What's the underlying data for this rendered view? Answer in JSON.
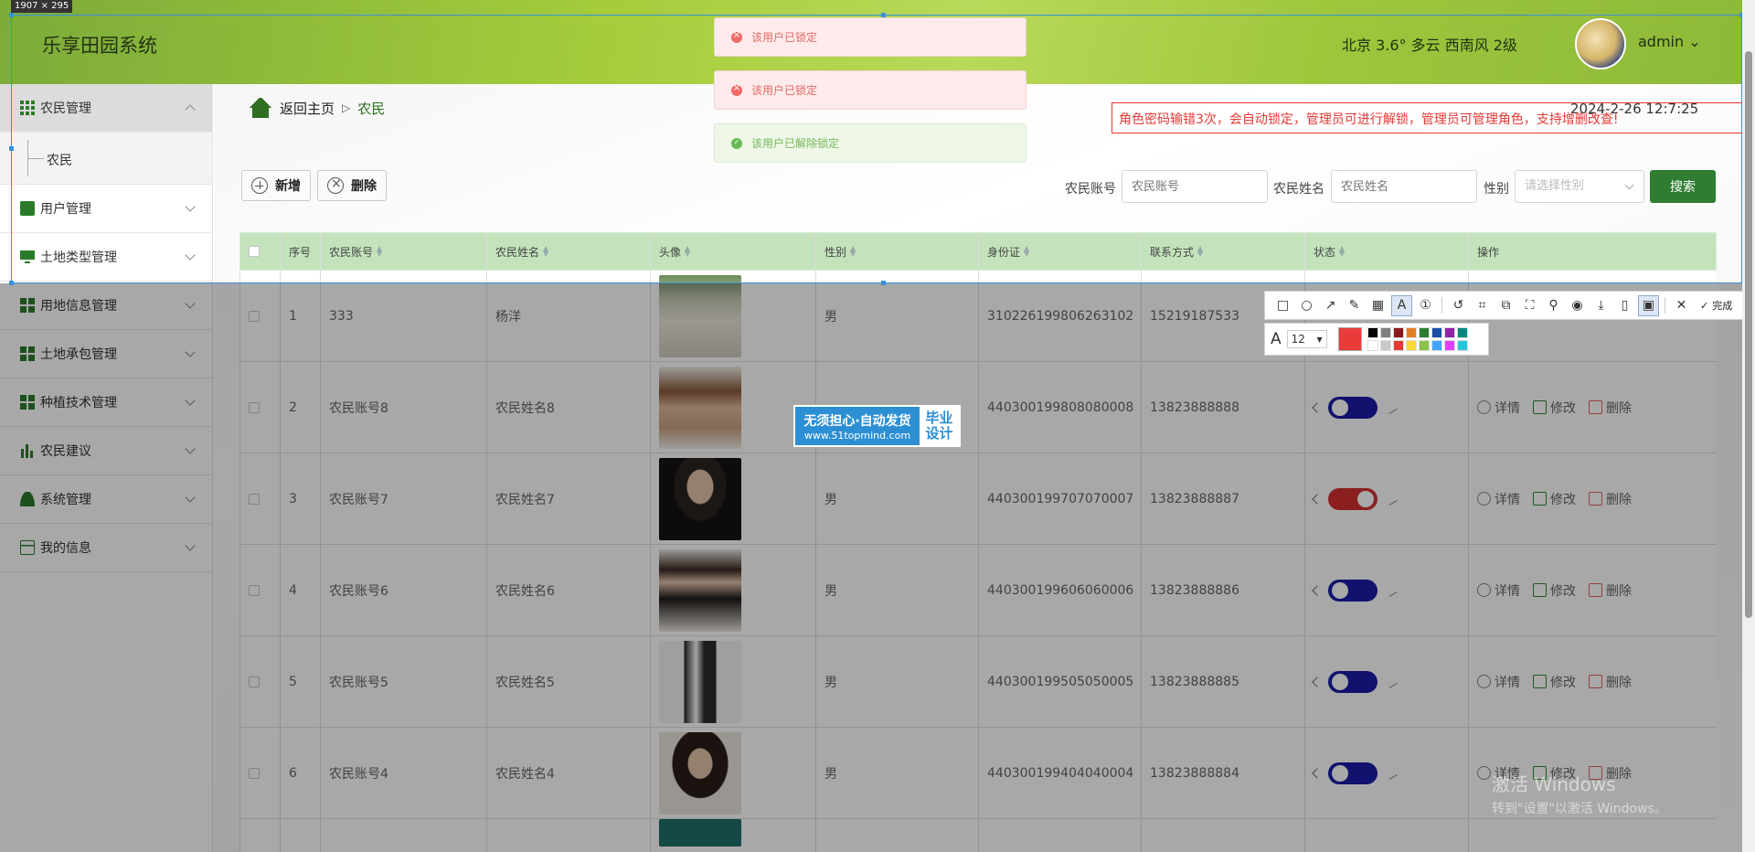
{
  "header": {
    "app_title": "乐享田园系统",
    "weather": "北京  3.6°  多云  西南风  2级",
    "username": "admin ⌄"
  },
  "sidebar": {
    "items": [
      {
        "label": "农民管理",
        "icon": "grid-icon"
      },
      {
        "label": "用户管理",
        "icon": "excel-icon"
      },
      {
        "label": "土地类型管理",
        "icon": "monitor-icon"
      },
      {
        "label": "用地信息管理",
        "icon": "blocks-icon"
      },
      {
        "label": "土地承包管理",
        "icon": "blocks-icon"
      },
      {
        "label": "种植技术管理",
        "icon": "blocks-icon"
      },
      {
        "label": "农民建议",
        "icon": "bar-chart-icon"
      },
      {
        "label": "系统管理",
        "icon": "user-icon"
      },
      {
        "label": "我的信息",
        "icon": "card-icon"
      }
    ],
    "sub_item": "农民"
  },
  "breadcrumb": {
    "home": "返回主页",
    "separator": "▷",
    "current": "农民"
  },
  "datetime": "2024-2-26 12:7:25",
  "toolbar": {
    "add_label": "新增",
    "delete_label": "删除"
  },
  "filters": {
    "account_label": "农民账号",
    "account_placeholder": "农民账号",
    "name_label": "农民姓名",
    "name_placeholder": "农民姓名",
    "gender_label": "性别",
    "gender_placeholder": "请选择性别",
    "search_label": "搜索"
  },
  "table": {
    "headers": [
      "序号",
      "农民账号",
      "农民姓名",
      "头像",
      "性别",
      "身份证",
      "联系方式",
      "状态",
      "操作"
    ],
    "rows": [
      {
        "no": "1",
        "account": "333",
        "name": "杨洋",
        "gender": "男",
        "id_card": "310226199806263102",
        "phone": "15219187533",
        "status_on": null
      },
      {
        "no": "2",
        "account": "农民账号8",
        "name": "农民姓名8",
        "gender": "",
        "id_card": "440300199808080008",
        "phone": "13823888888",
        "status_on": false
      },
      {
        "no": "3",
        "account": "农民账号7",
        "name": "农民姓名7",
        "gender": "男",
        "id_card": "440300199707070007",
        "phone": "13823888887",
        "status_on": true
      },
      {
        "no": "4",
        "account": "农民账号6",
        "name": "农民姓名6",
        "gender": "男",
        "id_card": "440300199606060006",
        "phone": "13823888886",
        "status_on": false
      },
      {
        "no": "5",
        "account": "农民账号5",
        "name": "农民姓名5",
        "gender": "男",
        "id_card": "440300199505050005",
        "phone": "13823888885",
        "status_on": false
      },
      {
        "no": "6",
        "account": "农民账号4",
        "name": "农民姓名4",
        "gender": "男",
        "id_card": "440300199404040004",
        "phone": "13823888884",
        "status_on": false
      }
    ],
    "actions": {
      "detail": "详情",
      "edit": "修改",
      "delete": "删除"
    }
  },
  "toasts": [
    {
      "type": "error",
      "text": "该用户已锁定"
    },
    {
      "type": "error",
      "text": "该用户已锁定"
    },
    {
      "type": "success",
      "text": "该用户已解除锁定"
    }
  ],
  "annotation": "角色密码输错3次，会自动锁定，管理员可进行解锁，管理员可管理角色，支持增删改查!",
  "capture": {
    "size_label": "1907 × 295",
    "done_label": "完成",
    "font_size": "12"
  },
  "watermark": {
    "line1": "无须担心·自动发货",
    "line2": "www.51topmind.com",
    "right1": "毕业",
    "right2": "设计"
  },
  "windows_watermark": {
    "line1": "激活 Windows",
    "line2": "转到\"设置\"以激活 Windows。"
  },
  "colors": {
    "primary_green": "#2e7d32",
    "header_green": "#a5cd3b",
    "table_header": "#c4e3bc",
    "toggle_on": "#d32f2f",
    "toggle_off": "#1a1aa8",
    "annotation_red": "#e53935"
  }
}
